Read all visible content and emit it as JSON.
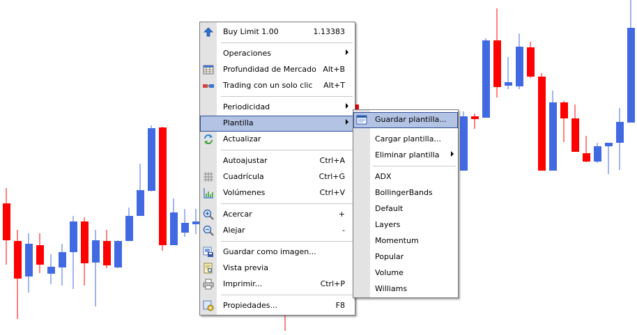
{
  "colors": {
    "bull": "#4169e1",
    "bear": "#ff0000",
    "menu_bg": "#ffffff",
    "gutter": "#e3e3e3",
    "highlight": "#b3c3e3",
    "highlight_border": "#324f9a"
  },
  "context_menu": {
    "buy_limit": {
      "label": "Buy Limit 1.00",
      "price": "1.13383",
      "icon": "up-arrow-icon"
    },
    "operaciones": {
      "label": "Operaciones"
    },
    "profundidad": {
      "label": "Profundidad de Mercado",
      "shortcut": "Alt+B",
      "icon": "market-depth-icon"
    },
    "one_click": {
      "label": "Trading con un solo clic",
      "shortcut": "Alt+T",
      "icon": "one-click-icon"
    },
    "periodicidad": {
      "label": "Periodicidad"
    },
    "plantilla": {
      "label": "Plantilla"
    },
    "actualizar": {
      "label": "Actualizar",
      "icon": "refresh-icon"
    },
    "autoajustar": {
      "label": "Autoajustar",
      "shortcut": "Ctrl+A"
    },
    "cuadricula": {
      "label": "Cuadrícula",
      "shortcut": "Ctrl+G",
      "icon": "grid-icon"
    },
    "volumenes": {
      "label": "Volúmenes",
      "shortcut": "Ctrl+V",
      "icon": "volumes-icon"
    },
    "acercar": {
      "label": "Acercar",
      "shortcut": "+",
      "icon": "zoom-in-icon"
    },
    "alejar": {
      "label": "Alejar",
      "shortcut": "-",
      "icon": "zoom-out-icon"
    },
    "guardar_imagen": {
      "label": "Guardar como imagen...",
      "icon": "save-image-icon"
    },
    "vista_previa": {
      "label": "Vista previa",
      "icon": "print-preview-icon"
    },
    "imprimir": {
      "label": "Imprimir...",
      "shortcut": "Ctrl+P",
      "icon": "printer-icon"
    },
    "propiedades": {
      "label": "Propiedades...",
      "shortcut": "F8",
      "icon": "properties-icon"
    }
  },
  "submenu": {
    "guardar": {
      "label": "Guardar plantilla...",
      "icon": "save-template-icon"
    },
    "cargar": {
      "label": "Cargar plantilla..."
    },
    "eliminar": {
      "label": "Eliminar plantilla"
    },
    "templates": [
      "ADX",
      "BollingerBands",
      "Default",
      "Layers",
      "Momentum",
      "Popular",
      "Volume",
      "Williams"
    ]
  }
}
